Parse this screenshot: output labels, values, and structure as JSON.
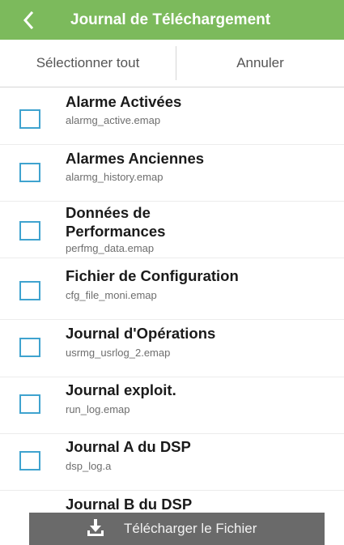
{
  "header": {
    "title": "Journal de Téléchargement",
    "back_icon": "chevron-left-icon"
  },
  "actions": {
    "select_all": "Sélectionner tout",
    "cancel": "Annuler"
  },
  "items": [
    {
      "title": "Alarme Activées",
      "file": "alarmg_active.emap"
    },
    {
      "title": "Alarmes Anciennes",
      "file": "alarmg_history.emap"
    },
    {
      "title": "Données de Performances",
      "file": "perfmg_data.emap"
    },
    {
      "title": "Fichier de Configuration",
      "file": "cfg_file_moni.emap"
    },
    {
      "title": "Journal d'Opérations",
      "file": "usrmg_usrlog_2.emap"
    },
    {
      "title": "Journal exploit.",
      "file": "run_log.emap"
    },
    {
      "title": "Journal A du DSP",
      "file": "dsp_log.a"
    },
    {
      "title": "Journal B du DSP",
      "file": ""
    }
  ],
  "download": {
    "label": "Télécharger le Fichier",
    "icon": "download-icon"
  },
  "colors": {
    "header_bg": "#7cba5c",
    "checkbox_border": "#3fa3cf",
    "download_bg": "#6a6a6a"
  }
}
